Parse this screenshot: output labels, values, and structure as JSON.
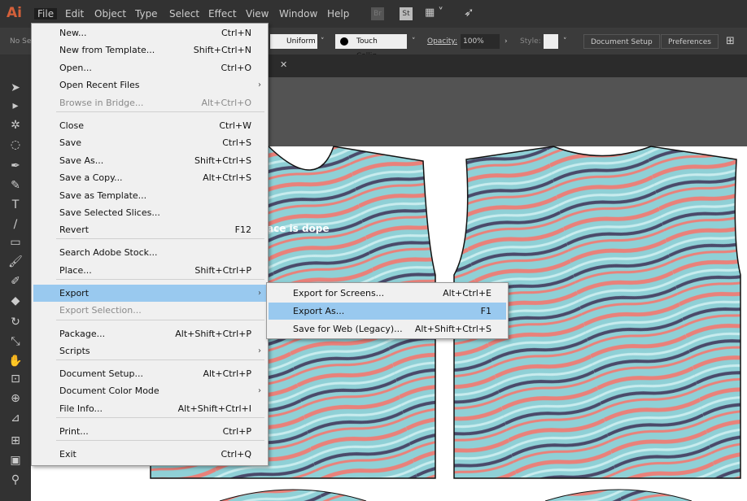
{
  "app": {
    "logo": "Ai"
  },
  "menubar": [
    "File",
    "Edit",
    "Object",
    "Type",
    "Select",
    "Effect",
    "View",
    "Window",
    "Help"
  ],
  "menubar_icons": {
    "br": "Br",
    "st": "St"
  },
  "options": {
    "selection": "No Se",
    "stroke_profile": "Uniform",
    "brush": "Touch Callig...",
    "opacity_label": "Opacity:",
    "opacity": "100%",
    "style_label": "Style:",
    "document_setup": "Document Setup",
    "preferences": "Preferences"
  },
  "file_menu": [
    {
      "label": "New...",
      "shortcut": "Ctrl+N"
    },
    {
      "label": "New from Template...",
      "shortcut": "Shift+Ctrl+N"
    },
    {
      "label": "Open...",
      "shortcut": "Ctrl+O"
    },
    {
      "label": "Open Recent Files",
      "shortcut": "",
      "submenu": true
    },
    {
      "label": "Browse in Bridge...",
      "shortcut": "Alt+Ctrl+O",
      "disabled": true
    },
    {
      "label": "Close",
      "shortcut": "Ctrl+W"
    },
    {
      "label": "Save",
      "shortcut": "Ctrl+S"
    },
    {
      "label": "Save As...",
      "shortcut": "Shift+Ctrl+S"
    },
    {
      "label": "Save a Copy...",
      "shortcut": "Alt+Ctrl+S"
    },
    {
      "label": "Save as Template...",
      "shortcut": ""
    },
    {
      "label": "Save Selected Slices...",
      "shortcut": ""
    },
    {
      "label": "Revert",
      "shortcut": "F12"
    },
    {
      "label": "Search Adobe Stock...",
      "shortcut": ""
    },
    {
      "label": "Place...",
      "shortcut": "Shift+Ctrl+P"
    },
    {
      "label": "Export",
      "shortcut": "",
      "submenu": true,
      "highlighted": true
    },
    {
      "label": "Export Selection...",
      "shortcut": "",
      "disabled": true
    },
    {
      "label": "Package...",
      "shortcut": "Alt+Shift+Ctrl+P"
    },
    {
      "label": "Scripts",
      "shortcut": "",
      "submenu": true
    },
    {
      "label": "Document Setup...",
      "shortcut": "Alt+Ctrl+P"
    },
    {
      "label": "Document Color Mode",
      "shortcut": "",
      "submenu": true
    },
    {
      "label": "File Info...",
      "shortcut": "Alt+Shift+Ctrl+I"
    },
    {
      "label": "Print...",
      "shortcut": "Ctrl+P"
    },
    {
      "label": "Exit",
      "shortcut": "Ctrl+Q"
    }
  ],
  "export_submenu": [
    {
      "label": "Export for Screens...",
      "shortcut": "Alt+Ctrl+E"
    },
    {
      "label": "Export As...",
      "shortcut": "F1",
      "highlighted": true
    },
    {
      "label": "Save for Web (Legacy)...",
      "shortcut": "Alt+Shift+Ctrl+S"
    }
  ],
  "canvas": {
    "artwork_text": "ace is dope"
  },
  "colors": {
    "teal": "#8fd0d6",
    "coral": "#e9817a",
    "navy": "#4a4a6a",
    "highlight": "#99c9ef"
  }
}
